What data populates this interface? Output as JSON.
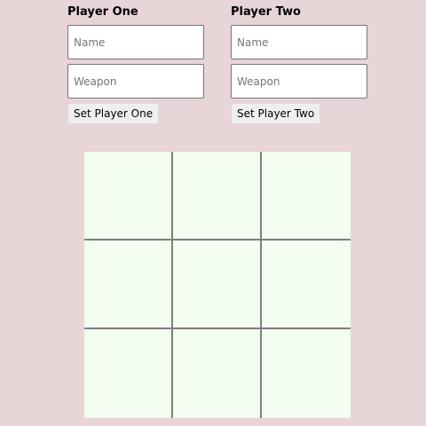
{
  "player_one": {
    "title": "Player One",
    "name_placeholder": "Name",
    "weapon_placeholder": "Weapon",
    "name_value": "",
    "weapon_value": "",
    "button_label": "Set Player One"
  },
  "player_two": {
    "title": "Player Two",
    "name_placeholder": "Name",
    "weapon_placeholder": "Weapon",
    "name_value": "",
    "weapon_value": "",
    "button_label": "Set Player Two"
  },
  "board": {
    "cells": [
      "",
      "",
      "",
      "",
      "",
      "",
      "",
      "",
      ""
    ]
  },
  "colors": {
    "page_background": "#e8d5d8",
    "cell_background": "#f2fcef",
    "grid_line": "#7f7f7f"
  }
}
